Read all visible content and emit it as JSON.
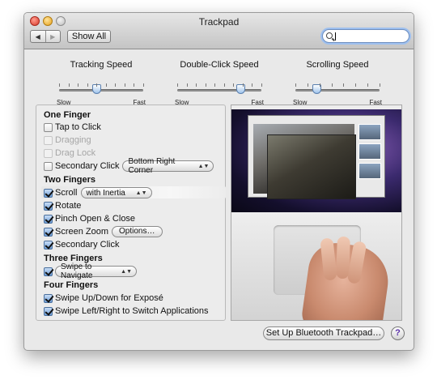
{
  "window": {
    "title": "Trackpad"
  },
  "toolbar": {
    "back_icon": "◀",
    "forward_icon": "▶",
    "show_all_label": "Show All",
    "search_value": ""
  },
  "sliders": [
    {
      "title": "Tracking Speed",
      "min_label": "Slow",
      "max_label": "Fast",
      "value": 0.45,
      "ticks": 10
    },
    {
      "title": "Double-Click Speed",
      "min_label": "Slow",
      "max_label": "Fast",
      "value": 0.75,
      "ticks": 10
    },
    {
      "title": "Scrolling Speed",
      "min_label": "Slow",
      "max_label": "Fast",
      "value": 0.25,
      "ticks": 8
    }
  ],
  "one_finger": {
    "heading": "One Finger",
    "tap_to_click": {
      "label": "Tap to Click",
      "checked": false
    },
    "dragging": {
      "label": "Dragging",
      "checked": false,
      "disabled": true
    },
    "drag_lock": {
      "label": "Drag Lock",
      "checked": false,
      "disabled": true
    },
    "secondary_click": {
      "label": "Secondary Click",
      "checked": false,
      "popup": "Bottom Right Corner"
    }
  },
  "two_fingers": {
    "heading": "Two Fingers",
    "scroll": {
      "label": "Scroll",
      "checked": true,
      "popup": "with Inertia"
    },
    "rotate": {
      "label": "Rotate",
      "checked": true
    },
    "pinch": {
      "label": "Pinch Open & Close",
      "checked": true
    },
    "screen_zoom": {
      "label": "Screen Zoom",
      "checked": true,
      "button": "Options…"
    },
    "secondary_click": {
      "label": "Secondary Click",
      "checked": true
    }
  },
  "three_fingers": {
    "heading": "Three Fingers",
    "swipe": {
      "checked": true,
      "popup": "Swipe to Navigate"
    }
  },
  "four_fingers": {
    "heading": "Four Fingers",
    "expose": {
      "label": "Swipe Up/Down for Exposé",
      "checked": true
    },
    "switch_apps": {
      "label": "Swipe Left/Right to Switch Applications",
      "checked": true
    }
  },
  "footer": {
    "bluetooth_label": "Set Up Bluetooth Trackpad…",
    "help_label": "?"
  },
  "colors": {
    "accent": "#6e9fd8",
    "help_icon": "#5a2fa8"
  }
}
